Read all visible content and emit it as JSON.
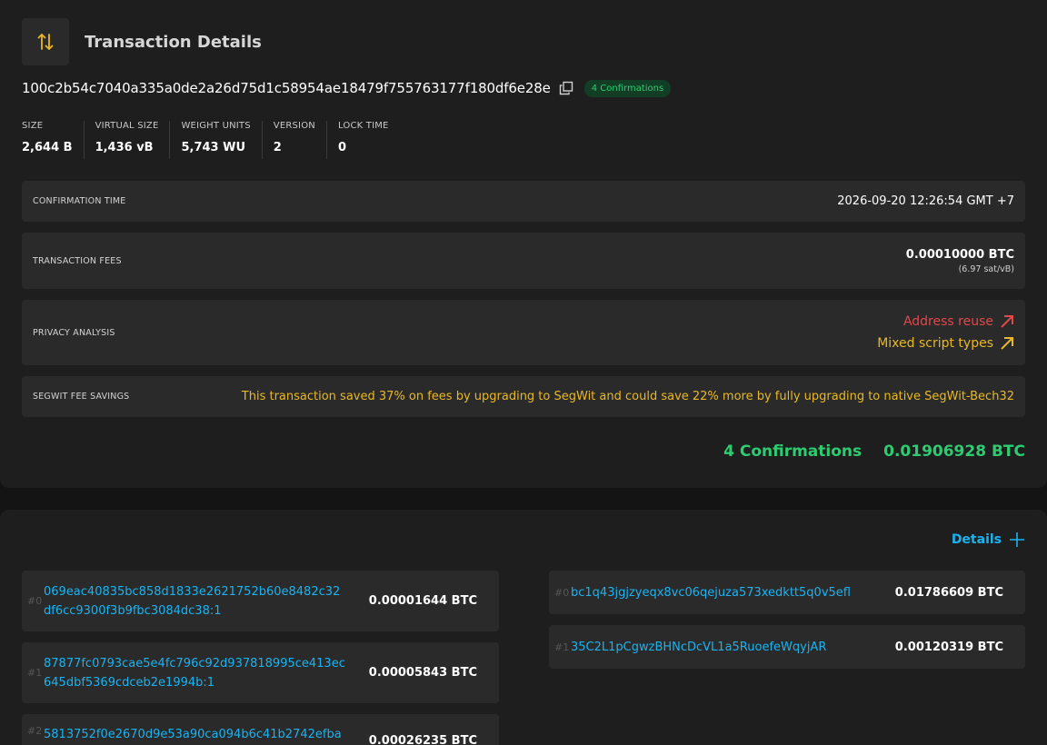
{
  "header": {
    "title": "Transaction Details",
    "icon": "swap-vertical-icon"
  },
  "txid": "100c2b54c7040a335a0de2a26d75d1c58954ae18479f755763177f180df6e28e",
  "confirmations_badge": "4 Confirmations",
  "stats": [
    {
      "label": "SIZE",
      "value": "2,644 B"
    },
    {
      "label": "VIRTUAL SIZE",
      "value": "1,436 vB"
    },
    {
      "label": "WEIGHT UNITS",
      "value": "5,743 WU"
    },
    {
      "label": "VERSION",
      "value": "2"
    },
    {
      "label": "LOCK TIME",
      "value": "0"
    }
  ],
  "confirmation_time": {
    "label": "CONFIRMATION TIME",
    "value": "2026-09-20 12:26:54 GMT +7"
  },
  "fees": {
    "label": "TRANSACTION FEES",
    "value": "0.00010000 BTC",
    "rate": "(6.97 sat/vB)"
  },
  "privacy": {
    "label": "PRIVACY ANALYSIS",
    "items": [
      {
        "text": "Address reuse",
        "color": "#e0484a"
      },
      {
        "text": "Mixed script types",
        "color": "#e9b824"
      }
    ]
  },
  "segwit": {
    "label": "SEGWIT FEE SAVINGS",
    "text": "This transaction saved 37% on fees by upgrading to SegWit and could save 22% more by fully upgrading to native SegWit-Bech32"
  },
  "summary": {
    "confirmations": "4 Confirmations",
    "amount": "0.01906928 BTC"
  },
  "details_link": "Details",
  "inputs": [
    {
      "index": "#0",
      "line1": "069eac40835bc858d1833e2621752b60e8482c32",
      "line2": "df6cc9300f3b9fbc3084dc38:1",
      "amount": "0.00001644 BTC"
    },
    {
      "index": "#1",
      "line1": "87877fc0793cae5e4fc796c92d937818995ce413ec",
      "line2": "645dbf5369cdceb2e1994b:1",
      "amount": "0.00005843 BTC"
    },
    {
      "index": "#2",
      "line1": "5813752f0e2670d9e53a90ca094b6c41b2742efba",
      "line2": "",
      "amount": "0.00026235 BTC"
    }
  ],
  "outputs": [
    {
      "index": "#0",
      "address": "bc1q43jgjzyeqx8vc06qejuza573xedktt5q0v5efl",
      "amount": "0.01786609 BTC"
    },
    {
      "index": "#1",
      "address": "35C2L1pCgwzBHNcDcVL1a5RuoefeWqyjAR",
      "amount": "0.00120319 BTC"
    }
  ],
  "colors": {
    "accent_green": "#2ecc71",
    "link_blue": "#1ab3f0",
    "warning_yellow": "#e9b824",
    "danger_red": "#e0484a"
  }
}
